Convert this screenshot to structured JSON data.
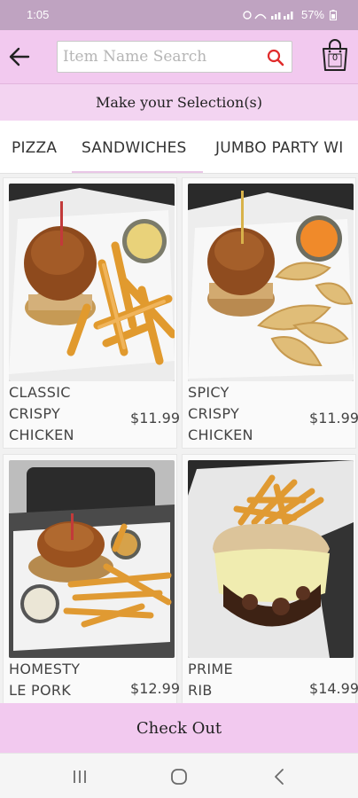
{
  "status_bar": {
    "time": "1:05",
    "battery": "57%",
    "icons": [
      "alarm-icon",
      "wifi-icon",
      "signal-icon",
      "battery-icon"
    ]
  },
  "header": {
    "search_placeholder": "Item Name Search",
    "cart_count": "0",
    "accent_color": "#f2c9ef",
    "search_icon_color": "#e02b2b"
  },
  "sub_header": {
    "title": "Make your Selection(s)"
  },
  "tabs": [
    {
      "label": "PIZZA",
      "active": false
    },
    {
      "label": "SANDWICHES",
      "active": true
    },
    {
      "label": "JUMBO PARTY WI",
      "active": false
    }
  ],
  "items": [
    {
      "name_lines": [
        "CLASSIC",
        "CRISPY",
        "CHICKEN"
      ],
      "price": "$11.99"
    },
    {
      "name_lines": [
        "SPICY",
        "CRISPY",
        "CHICKEN"
      ],
      "price": "$11.99"
    },
    {
      "name_lines": [
        "HOMESTY",
        "LE PORK"
      ],
      "price": "$12.99"
    },
    {
      "name_lines": [
        "PRIME",
        "RIB"
      ],
      "price": "$14.99"
    }
  ],
  "checkout": {
    "label": "Check Out"
  }
}
